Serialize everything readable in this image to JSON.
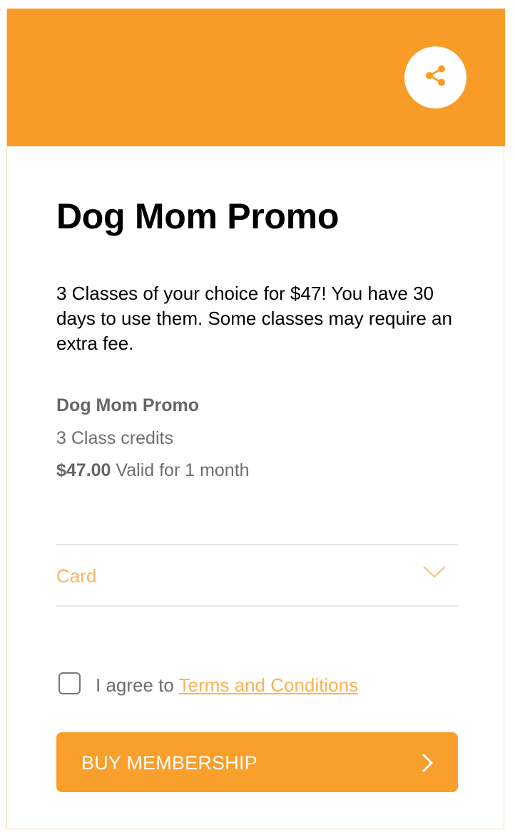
{
  "header": {
    "accent_color": "#f89c27",
    "share_icon": "share-icon"
  },
  "membership": {
    "title": "Dog Mom Promo",
    "description": "3 Classes of your choice for $47! You have 30 days to use them. Some classes may require an extra fee.",
    "detail_name": "Dog Mom Promo",
    "credits": "3 Class credits",
    "price": "$47.00",
    "validity": "Valid for 1 month"
  },
  "payment": {
    "selected": "Card",
    "icon": "chevron-down-icon"
  },
  "agreement": {
    "prefix": "I agree to",
    "link": "Terms and Conditions",
    "checked": false
  },
  "buy": {
    "label": "BUY MEMBERSHIP",
    "icon": "chevron-right-icon"
  }
}
